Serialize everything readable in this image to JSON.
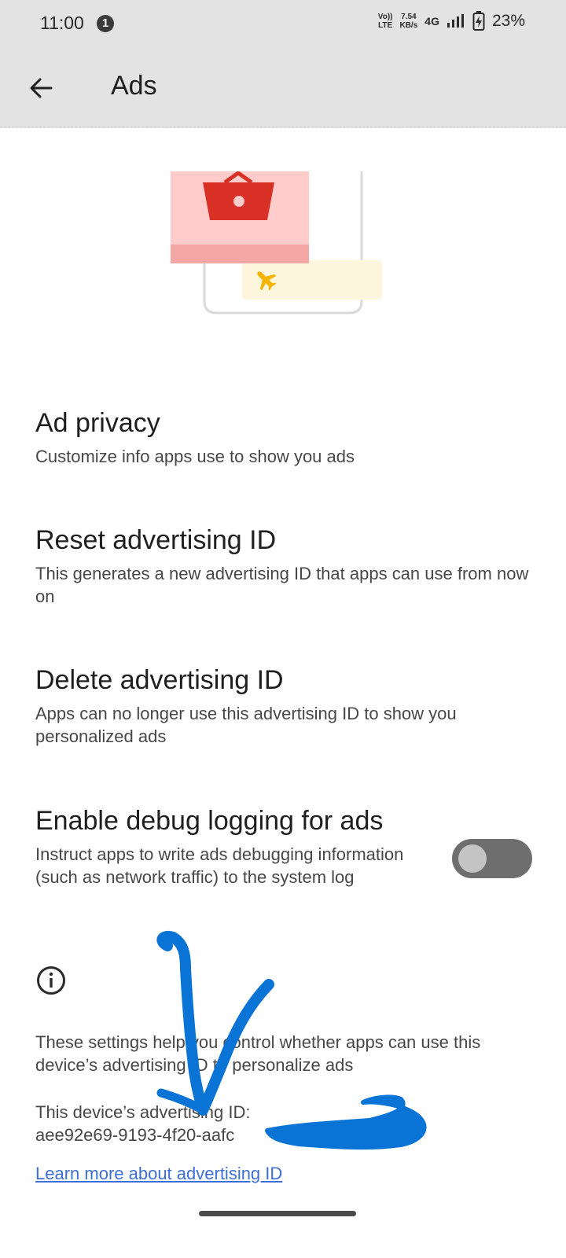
{
  "status_bar": {
    "time": "11:00",
    "notification_count": "1",
    "volte_top": "Vo))",
    "volte_bottom": "LTE",
    "speed_value": "7.54",
    "speed_unit": "KB/s",
    "network": "4G",
    "battery": "23%"
  },
  "app_bar": {
    "title": "Ads",
    "back_icon": "arrow-back-icon"
  },
  "illustration": {
    "icons": [
      "shopping-basket-icon",
      "airplane-icon"
    ],
    "colors": {
      "card_red": "#ffcccb",
      "card_red_strip": "#f5a7a6",
      "basket": "#d93025",
      "card_yellow": "#fdf5dc",
      "airplane": "#f4b400"
    }
  },
  "settings": [
    {
      "title": "Ad privacy",
      "summary": "Customize info apps use to show you ads"
    },
    {
      "title": "Reset advertising ID",
      "summary": "This generates a new advertising ID that apps can use from now on"
    },
    {
      "title": "Delete advertising ID",
      "summary": "Apps can no longer use this advertising ID to show you personalized ads"
    },
    {
      "title": "Enable debug logging for ads",
      "summary": "Instruct apps to write ads debugging information (such as network traffic) to the system log",
      "toggle_on": false
    }
  ],
  "footer": {
    "info_icon": "info-icon",
    "description": "These settings help you control whether apps can use this device’s advertising ID to personalize ads",
    "ad_id_label": "This device’s advertising ID:",
    "ad_id_value": "aee92e69-9193-4f20-aafc",
    "learn_more": "Learn more about advertising ID"
  },
  "annotation": {
    "scribble_color": "#0a73d6"
  }
}
